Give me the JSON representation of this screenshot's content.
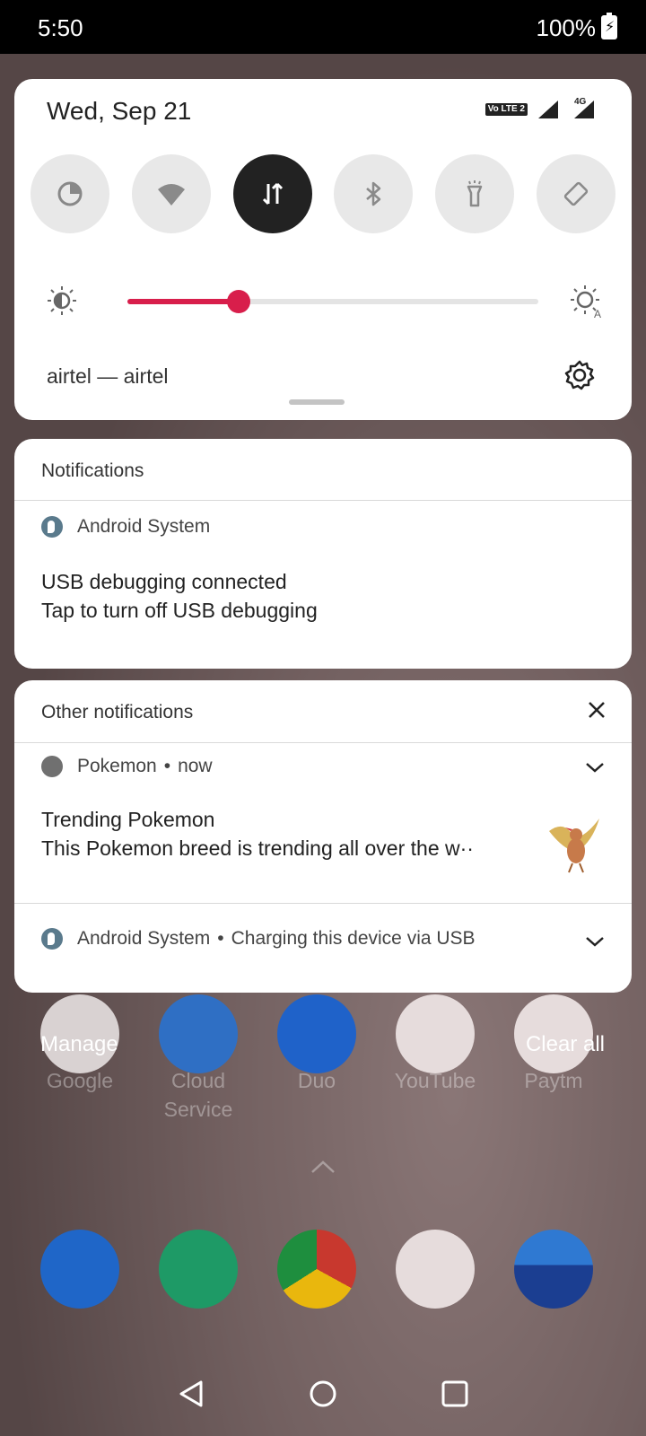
{
  "status_bar": {
    "time": "5:50",
    "battery": "100%"
  },
  "quick_settings": {
    "date": "Wed, Sep 21",
    "network_badge": "Vo LTE 2",
    "network_type": "4G",
    "tiles": [
      {
        "name": "data-saver",
        "active": false
      },
      {
        "name": "wifi",
        "active": false
      },
      {
        "name": "mobile-data",
        "active": true
      },
      {
        "name": "bluetooth",
        "active": false
      },
      {
        "name": "flashlight",
        "active": false
      },
      {
        "name": "auto-rotate",
        "active": false
      }
    ],
    "brightness_level": 0.27,
    "carrier": "airtel — airtel"
  },
  "notifications": {
    "title": "Notifications",
    "items": [
      {
        "app": "Android System",
        "title": "USB debugging connected",
        "text": "Tap to turn off USB debugging"
      }
    ]
  },
  "other_notifications": {
    "title": "Other notifications",
    "pokemon": {
      "app": "Pokemon",
      "time": "now",
      "title": "Trending Pokemon",
      "text": "This Pokemon breed is trending all over the w··"
    },
    "charging": {
      "app": "Android System",
      "text": "Charging this device via USB"
    }
  },
  "shade_actions": {
    "manage": "Manage",
    "clear_all": "Clear all"
  },
  "home_apps": [
    {
      "label": "Google"
    },
    {
      "label": "Cloud Service"
    },
    {
      "label": "Duo"
    },
    {
      "label": "YouTube"
    },
    {
      "label": "Paytm"
    }
  ],
  "colors": {
    "accent": "#d81e4b",
    "active_tile": "#222222"
  }
}
